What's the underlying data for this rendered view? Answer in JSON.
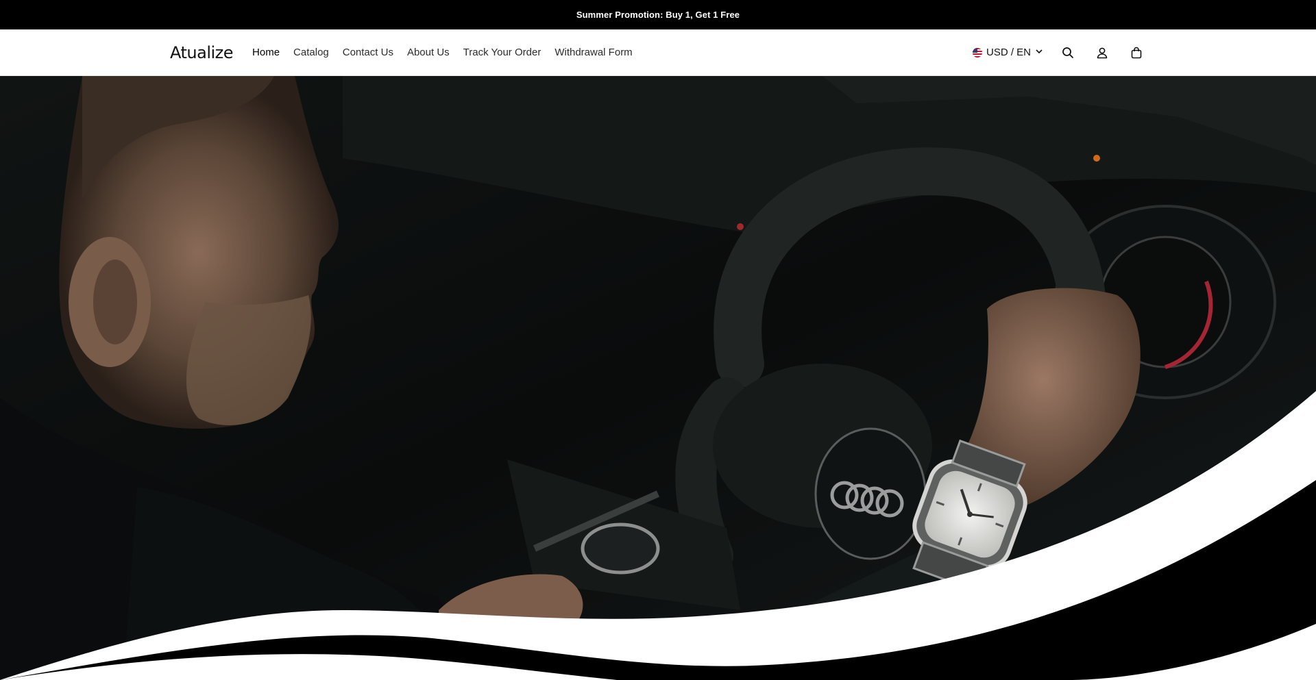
{
  "announcement": {
    "text": "Summer Promotion: Buy 1, Get 1 Free"
  },
  "header": {
    "logo": "Atualize",
    "nav": [
      {
        "label": "Home",
        "active": true
      },
      {
        "label": "Catalog"
      },
      {
        "label": "Contact Us"
      },
      {
        "label": "About Us"
      },
      {
        "label": "Track Your Order"
      },
      {
        "label": "Withdrawal Form"
      }
    ],
    "locale": {
      "label": "USD / EN",
      "flag": "us-flag-icon"
    },
    "icons": [
      "search-icon",
      "account-icon",
      "cart-icon"
    ]
  },
  "hero": {
    "image": "man-driving-car-wearing-wristwatch",
    "colors": {
      "background": "#0b0d0d",
      "wave": "#ffffff",
      "band": "#000000"
    }
  }
}
